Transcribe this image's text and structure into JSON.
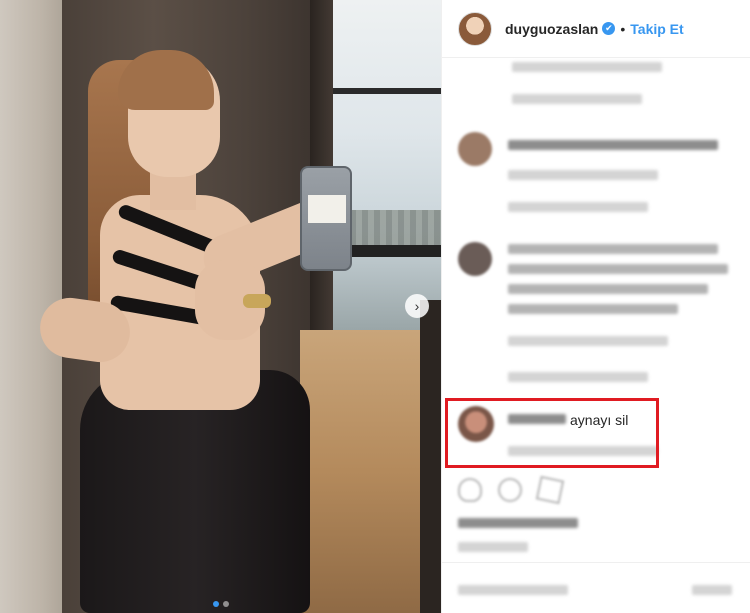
{
  "post": {
    "author": "duyguozaslan",
    "follow_label": "Takip Et",
    "separator": "•",
    "verified_glyph": "✔",
    "carousel": {
      "slide_count": 2,
      "active_slide": 1
    }
  },
  "highlighted_comment": {
    "text": "aynayı sil"
  },
  "icons": {
    "next": "chevron-right-icon",
    "verified": "verified-badge-icon",
    "like": "heart-icon",
    "comment": "comment-icon",
    "share": "share-icon"
  },
  "colors": {
    "accent": "#3897f0",
    "highlight_border": "#e01b22",
    "text": "#262626"
  }
}
